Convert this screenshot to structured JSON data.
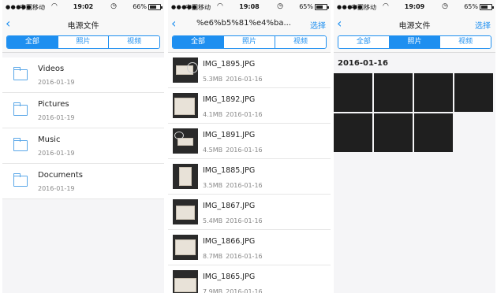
{
  "status_bars": [
    {
      "carrier": "中国移动",
      "time": "19:02",
      "battery": "66%",
      "battery_level": 0.66
    },
    {
      "carrier": "中国移动",
      "time": "19:08",
      "battery": "65%",
      "battery_level": 0.65
    },
    {
      "carrier": "中国移动",
      "time": "19:09",
      "battery": "65%",
      "battery_level": 0.65
    }
  ],
  "screen1": {
    "title": "电源文件",
    "tabs": [
      "全部",
      "照片",
      "视频"
    ],
    "active_tab": 0,
    "folders": [
      {
        "name": "Videos",
        "date": "2016-01-19"
      },
      {
        "name": "Pictures",
        "date": "2016-01-19"
      },
      {
        "name": "Music",
        "date": "2016-01-19"
      },
      {
        "name": "Documents",
        "date": "2016-01-19"
      }
    ]
  },
  "screen2": {
    "title": "%e6%b5%81%e4%ba...",
    "action": "选择",
    "tabs": [
      "全部",
      "照片",
      "视频"
    ],
    "active_tab": 0,
    "files": [
      {
        "name": "IMG_1895.JPG",
        "size": "5.3MB",
        "date": "2016-01-16"
      },
      {
        "name": "IMG_1892.JPG",
        "size": "4.1MB",
        "date": "2016-01-16"
      },
      {
        "name": "IMG_1891.JPG",
        "size": "4.5MB",
        "date": "2016-01-16"
      },
      {
        "name": "IMG_1885.JPG",
        "size": "3.5MB",
        "date": "2016-01-16"
      },
      {
        "name": "IMG_1867.JPG",
        "size": "5.4MB",
        "date": "2016-01-16"
      },
      {
        "name": "IMG_1866.JPG",
        "size": "8.7MB",
        "date": "2016-01-16"
      },
      {
        "name": "IMG_1865.JPG",
        "size": "7.9MB",
        "date": "2016-01-16"
      }
    ]
  },
  "screen3": {
    "title": "电源文件",
    "action": "选择",
    "tabs": [
      "全部",
      "照片",
      "视频"
    ],
    "active_tab": 1,
    "date_header": "2016-01-16",
    "photo_count": 7
  },
  "colors": {
    "accent": "#1e8ff0",
    "text": "#222222",
    "secondary": "#888888",
    "background": "#f5f5f7"
  },
  "icons": [
    "signal-icon",
    "wifi-icon",
    "alarm-icon",
    "battery-icon",
    "back-chevron-icon",
    "folder-icon"
  ]
}
